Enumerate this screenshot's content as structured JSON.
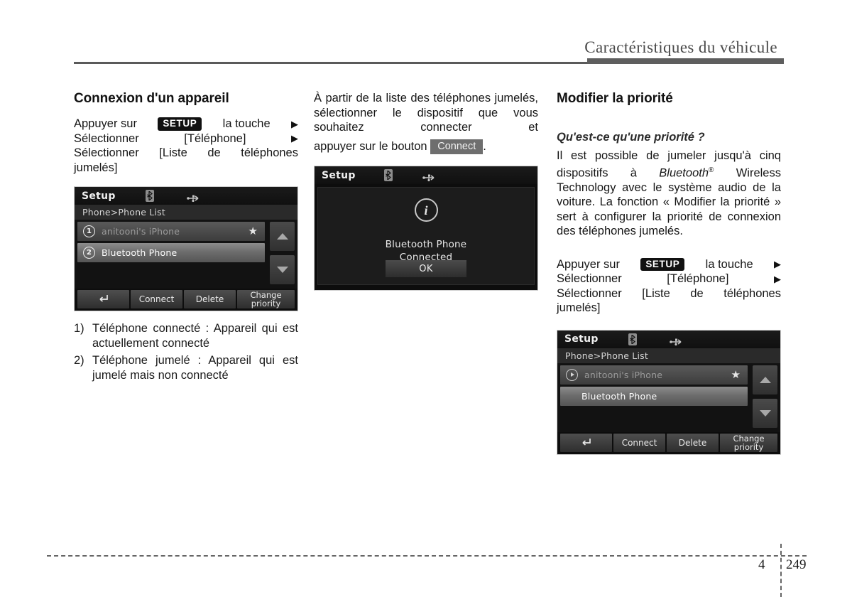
{
  "header": {
    "title": "Caractéristiques du véhicule"
  },
  "footer": {
    "chapter": "4",
    "page": "249"
  },
  "column_left": {
    "section_title": "Connexion d'un appareil",
    "steps": {
      "line1_a": "Appuyer sur",
      "line1_key": "SETUP",
      "line1_b": "la touche",
      "line1_arrow": "▶",
      "line2_a": "Sélectionner",
      "line2_b": "[Téléphone]",
      "line2_arrow": "▶",
      "line3": "Sélectionner [Liste de téléphones",
      "line4": "jumelés]"
    },
    "notes": [
      {
        "marker": "1)",
        "text": "Téléphone connecté : Appareil qui est actuellement connecté"
      },
      {
        "marker": "2)",
        "text": "Téléphone jumelé : Appareil qui est jumelé mais non connecté"
      }
    ]
  },
  "column_middle": {
    "paragraph_a": "À partir de la liste des téléphones jumelés, sélectionner le dispositif que vous souhaitez connecter et",
    "paragraph_b_pre": "appuyer sur le bouton",
    "paragraph_b_button": "Connect",
    "paragraph_b_post": "."
  },
  "column_right": {
    "section_title": "Modifier la priorité",
    "sub_title": "Qu'est-ce qu'une priorité ?",
    "paragraph_pre": "Il est possible de jumeler jusqu'à cinq dispositifs à",
    "paragraph_brand": "Bluetooth",
    "paragraph_brand_sup": "®",
    "paragraph_post": "Wireless Technology avec le système audio de la voiture. La fonction « Modifier la priorité » sert à configurer la priorité de connexion des téléphones jumelés.",
    "steps": {
      "line1_a": "Appuyer sur",
      "line1_key": "SETUP",
      "line1_b": "la touche",
      "line1_arrow": "▶",
      "line2_a": "Sélectionner",
      "line2_b": "[Téléphone]",
      "line2_arrow": "▶",
      "line3": "Sélectionner [Liste de téléphones",
      "line4": "jumelés]"
    }
  },
  "screen_phone_list_1": {
    "title": "Setup",
    "breadcrumb": "Phone>Phone List",
    "rows": [
      {
        "badge": "1",
        "label": "anitooni's iPhone",
        "starred": true,
        "state": "connected"
      },
      {
        "badge": "2",
        "label": "Bluetooth Phone",
        "starred": false,
        "state": "paired"
      }
    ],
    "toolbar": [
      {
        "label": "back",
        "type": "icon"
      },
      {
        "label": "Connect",
        "type": "text"
      },
      {
        "label": "Delete",
        "type": "text"
      },
      {
        "label": "Change priority",
        "type": "text2"
      }
    ],
    "scroll_up": "▲",
    "scroll_down": "▼"
  },
  "screen_dialog": {
    "title": "Setup",
    "info_glyph": "i",
    "message_line1": "Bluetooth Phone",
    "message_line2": "Connected",
    "ok_label": "OK"
  },
  "screen_phone_list_2": {
    "title": "Setup",
    "breadcrumb": "Phone>Phone List",
    "rows": [
      {
        "badge": "play",
        "label": "anitooni's iPhone",
        "starred": true,
        "state": "connected"
      },
      {
        "badge": "",
        "label": "Bluetooth Phone",
        "starred": false,
        "state": "paired"
      }
    ],
    "toolbar": [
      {
        "label": "back",
        "type": "icon"
      },
      {
        "label": "Connect",
        "type": "text"
      },
      {
        "label": "Delete",
        "type": "text"
      },
      {
        "label": "Change priority",
        "type": "text2"
      }
    ],
    "scroll_up": "▲",
    "scroll_down": "▼"
  },
  "icons": {
    "bluetooth": "bluetooth-icon",
    "usb": "usb-icon",
    "star": "★",
    "back": "↰"
  },
  "colors": {
    "header_rule": "#5a5a5a",
    "key_badge_bg": "#111111",
    "btn_badge_bg": "#6e6e6e",
    "device_bg": "#0d0d0d"
  }
}
